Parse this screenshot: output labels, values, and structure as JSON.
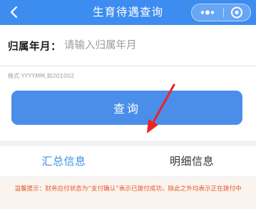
{
  "header": {
    "title": "生育待遇查询",
    "back_icon": "chevron-left-icon",
    "more_icon": "more-dots-icon",
    "close_icon": "target-circle-icon"
  },
  "form": {
    "label": "归属年月：",
    "placeholder": "请输入归属年月",
    "value": "",
    "hint": "格式:YYYYMM,如201002",
    "query_button": "查询"
  },
  "tabs": [
    {
      "label": "汇总信息",
      "active": true
    },
    {
      "label": "明细信息",
      "active": false
    }
  ],
  "notice": {
    "text": "温馨提示：财务应付状态为“支付确认”表示已拨付成功，除此之外均表示正在拨付中"
  },
  "colors": {
    "header_bg": "#3d8df0",
    "button_bg": "#4a8eea",
    "active_tab": "#3b8fe6",
    "notice_text": "#e05a2a",
    "annotation_arrow": "#ee2222"
  }
}
